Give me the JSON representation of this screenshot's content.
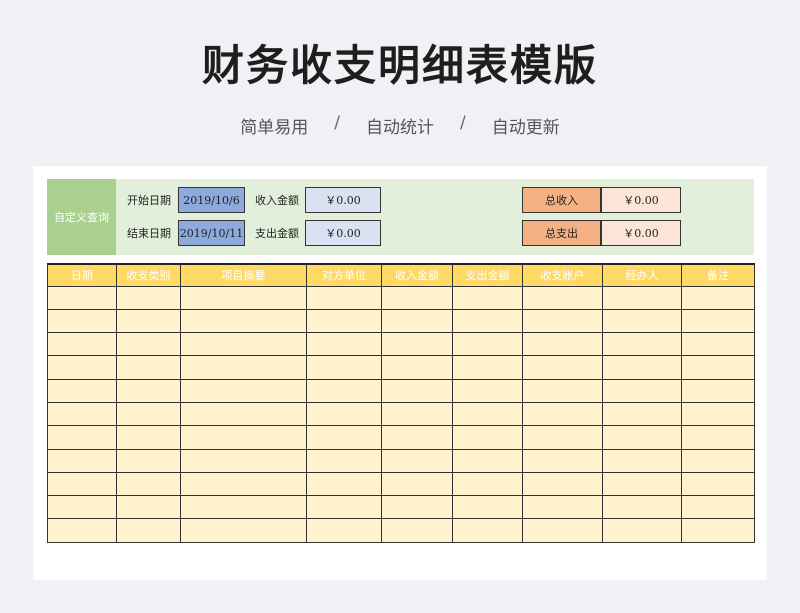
{
  "header": {
    "title": "财务收支明细表模版",
    "features": [
      "简单易用",
      "自动统计",
      "自动更新"
    ],
    "separator": "/"
  },
  "query": {
    "label": "自定义查询",
    "start_date_label": "开始日期",
    "start_date_value": "2019/10/6",
    "end_date_label": "结束日期",
    "end_date_value": "2019/10/11",
    "income_amount_label": "收入金额",
    "income_amount_value": "￥0.00",
    "expense_amount_label": "支出金额",
    "expense_amount_value": "￥0.00",
    "total_income_label": "总收入",
    "total_income_value": "￥0.00",
    "total_expense_label": "总支出",
    "total_expense_value": "￥0.00"
  },
  "table": {
    "columns": [
      "日期",
      "收支类别",
      "项目摘要",
      "对方单位",
      "收入金额",
      "支出金额",
      "收支账户",
      "经办人",
      "备注"
    ],
    "row_count": 11
  },
  "colors": {
    "query_bg": "#e2efda",
    "query_label_bg": "#a9d08e",
    "date_box": "#8ea9db",
    "amount_box": "#d9e1f2",
    "total_label": "#f4b183",
    "total_value": "#fce4d6",
    "table_header": "#ffd966",
    "table_cell": "#fff2cc"
  }
}
